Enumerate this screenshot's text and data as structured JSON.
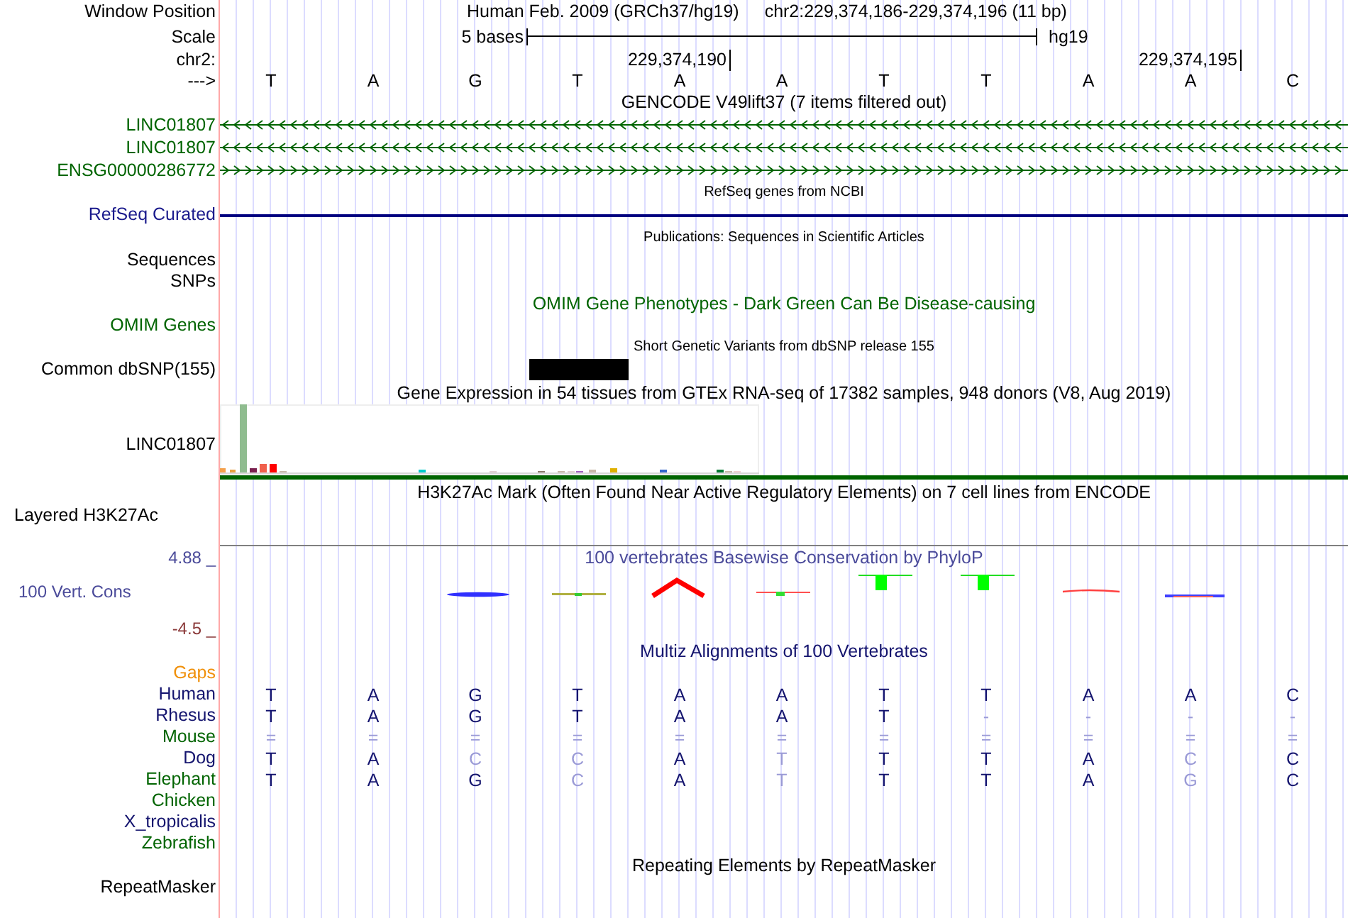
{
  "header": {
    "position_label": "Window Position",
    "assembly": "Human Feb. 2009 (GRCh37/hg19)",
    "position": "chr2:229,374,186-229,374,196 (11 bp)",
    "scale_label": "Scale",
    "scale_length": "5 bases",
    "scale_assembly": "hg19",
    "chrom_label": "chr2:",
    "ticks": [
      "229,374,190",
      "229,374,195"
    ],
    "strand_label": "--->",
    "bases": [
      "T",
      "A",
      "G",
      "T",
      "A",
      "A",
      "T",
      "T",
      "A",
      "A",
      "C"
    ]
  },
  "gencode": {
    "title": "GENCODE V49lift37 (7 items filtered out)",
    "items": [
      {
        "name": "LINC01807",
        "kind": "reverse"
      },
      {
        "name": "LINC01807",
        "kind": "reverse"
      },
      {
        "name": "ENSG00000286772",
        "kind": "forward"
      }
    ]
  },
  "refseq": {
    "title": "RefSeq genes from NCBI",
    "label": "RefSeq Curated"
  },
  "publications": {
    "title": "Publications: Sequences in Scientific Articles",
    "labels": [
      "Sequences",
      "SNPs"
    ]
  },
  "omim": {
    "title": "OMIM Gene Phenotypes - Dark Green Can Be Disease-causing",
    "label": "OMIM Genes"
  },
  "dbsnp": {
    "title": "Short Genetic Variants from dbSNP release 155",
    "label": "Common dbSNP(155)"
  },
  "gtex": {
    "title": "Gene Expression in 54 tissues from GTEx RNA-seq of 17382 samples, 948 donors (V8, Aug 2019)",
    "label": "LINC01807"
  },
  "h3k27ac": {
    "title": "H3K27Ac Mark (Often Found Near Active Regulatory Elements) on 7 cell lines from ENCODE",
    "label": "Layered H3K27Ac"
  },
  "phylop": {
    "title": "100 vertebrates Basewise Conservation by PhyloP",
    "label": "100 Vert. Cons",
    "max": "4.88 _",
    "min": "-4.5 _"
  },
  "multiz": {
    "title": "Multiz Alignments of 100 Vertebrates",
    "gaps_label": "Gaps",
    "species": [
      {
        "name": "Human",
        "color": "#14146e",
        "bases": [
          {
            "base": "T",
            "conserved": true
          },
          {
            "base": "A",
            "conserved": true
          },
          {
            "base": "G",
            "conserved": true
          },
          {
            "base": "T",
            "conserved": true
          },
          {
            "base": "A",
            "conserved": true
          },
          {
            "base": "A",
            "conserved": true
          },
          {
            "base": "T",
            "conserved": true
          },
          {
            "base": "T",
            "conserved": true
          },
          {
            "base": "A",
            "conserved": true
          },
          {
            "base": "A",
            "conserved": true
          },
          {
            "base": "C",
            "conserved": true
          }
        ]
      },
      {
        "name": "Rhesus",
        "color": "#14146e",
        "bases": [
          {
            "base": "T",
            "conserved": true
          },
          {
            "base": "A",
            "conserved": true
          },
          {
            "base": "G",
            "conserved": true
          },
          {
            "base": "T",
            "conserved": true
          },
          {
            "base": "A",
            "conserved": true
          },
          {
            "base": "A",
            "conserved": true
          },
          {
            "base": "T",
            "conserved": true
          },
          {
            "base": "-",
            "conserved": false
          },
          {
            "base": "-",
            "conserved": false
          },
          {
            "base": "-",
            "conserved": false
          },
          {
            "base": "-",
            "conserved": false
          }
        ]
      },
      {
        "name": "Mouse",
        "color": "#006400",
        "bases": [
          {
            "base": "=",
            "conserved": false
          },
          {
            "base": "=",
            "conserved": false
          },
          {
            "base": "=",
            "conserved": false
          },
          {
            "base": "=",
            "conserved": false
          },
          {
            "base": "=",
            "conserved": false
          },
          {
            "base": "=",
            "conserved": false
          },
          {
            "base": "=",
            "conserved": false
          },
          {
            "base": "=",
            "conserved": false
          },
          {
            "base": "=",
            "conserved": false
          },
          {
            "base": "=",
            "conserved": false
          },
          {
            "base": "=",
            "conserved": false
          }
        ]
      },
      {
        "name": "Dog",
        "color": "#14146e",
        "bases": [
          {
            "base": "T",
            "conserved": true
          },
          {
            "base": "A",
            "conserved": true
          },
          {
            "base": "C",
            "conserved": false
          },
          {
            "base": "C",
            "conserved": false
          },
          {
            "base": "A",
            "conserved": true
          },
          {
            "base": "T",
            "conserved": false
          },
          {
            "base": "T",
            "conserved": true
          },
          {
            "base": "T",
            "conserved": true
          },
          {
            "base": "A",
            "conserved": true
          },
          {
            "base": "C",
            "conserved": false
          },
          {
            "base": "C",
            "conserved": true
          }
        ]
      },
      {
        "name": "Elephant",
        "color": "#006400",
        "bases": [
          {
            "base": "T",
            "conserved": true
          },
          {
            "base": "A",
            "conserved": true
          },
          {
            "base": "G",
            "conserved": true
          },
          {
            "base": "C",
            "conserved": false
          },
          {
            "base": "A",
            "conserved": true
          },
          {
            "base": "T",
            "conserved": false
          },
          {
            "base": "T",
            "conserved": true
          },
          {
            "base": "T",
            "conserved": true
          },
          {
            "base": "A",
            "conserved": true
          },
          {
            "base": "G",
            "conserved": false
          },
          {
            "base": "C",
            "conserved": true
          }
        ]
      },
      {
        "name": "Chicken",
        "color": "#006400"
      },
      {
        "name": "X_tropicalis",
        "color": "#14146e"
      },
      {
        "name": "Zebrafish",
        "color": "#006400"
      }
    ]
  },
  "repeatmasker": {
    "title": "Repeating Elements by RepeatMasker",
    "label": "RepeatMasker"
  }
}
